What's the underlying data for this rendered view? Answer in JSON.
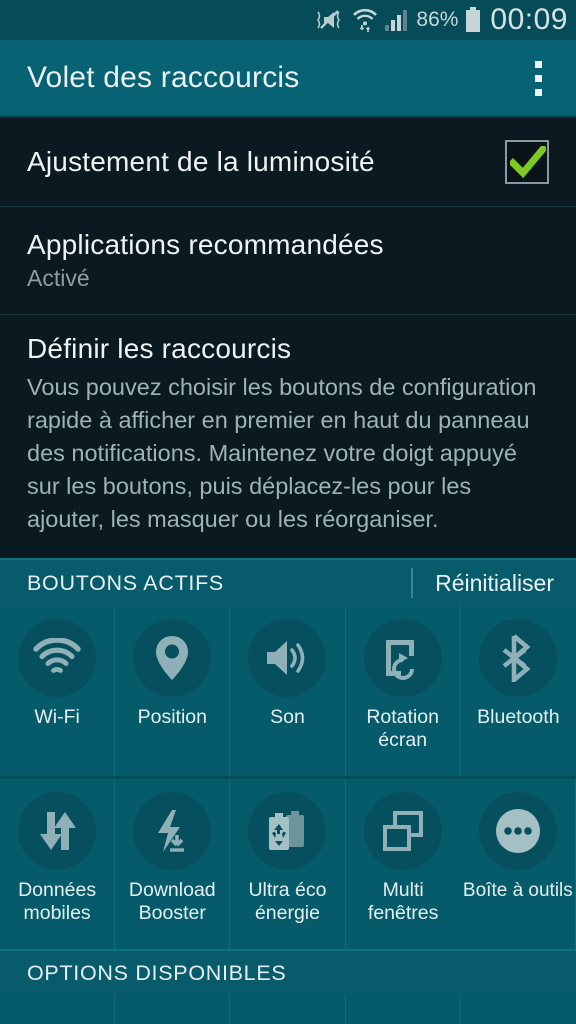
{
  "statusbar": {
    "icons": [
      "mute-vibrate-icon",
      "wifi-data-icon",
      "cellular-signal-icon",
      "battery-icon"
    ],
    "battery_percent": "86%",
    "clock": "00:09"
  },
  "actionbar": {
    "title": "Volet des raccourcis",
    "overflow_icon": "overflow-menu-icon"
  },
  "settings": {
    "brightness": {
      "label": "Ajustement de la luminosité",
      "checked": true,
      "check_color": "#7ec824"
    },
    "recommended_apps": {
      "label": "Applications recommandées",
      "value": "Activé"
    },
    "define_shortcuts": {
      "label": "Définir les raccourcis",
      "description": "Vous pouvez choisir les boutons de configuration rapide à afficher en premier en haut du panneau des notifications. Maintenez votre doigt appuyé sur les boutons, puis déplacez-les pour les ajouter, les masquer ou les réorganiser."
    }
  },
  "active_section": {
    "header": "BOUTONS ACTIFS",
    "reset_label": "Réinitialiser",
    "buttons": [
      {
        "label": "Wi-Fi",
        "icon": "wifi-icon"
      },
      {
        "label": "Position",
        "icon": "location-pin-icon"
      },
      {
        "label": "Son",
        "icon": "sound-speaker-icon"
      },
      {
        "label": "Rotation\nécran",
        "icon": "screen-rotation-icon"
      },
      {
        "label": "Bluetooth",
        "icon": "bluetooth-icon"
      },
      {
        "label": "Données\nmobiles",
        "icon": "mobile-data-icon"
      },
      {
        "label": "Download\nBooster",
        "icon": "download-booster-icon"
      },
      {
        "label": "Ultra éco\nénergie",
        "icon": "ultra-power-saving-icon"
      },
      {
        "label": "Multi\nfenêtres",
        "icon": "multi-window-icon"
      },
      {
        "label": "Boîte à outils",
        "icon": "toolbox-dots-icon"
      }
    ]
  },
  "available_section": {
    "header": "OPTIONS DISPONIBLES"
  },
  "theme": {
    "accent_teal": "#076273",
    "grid_teal": "#065b6a",
    "panel_dark": "#0b1a20",
    "text_primary": "#eef3f4",
    "text_secondary": "#9fb2b6"
  }
}
